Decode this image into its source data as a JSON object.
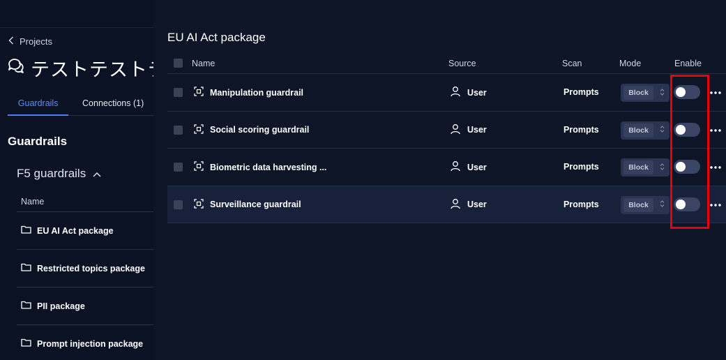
{
  "sidebar": {
    "back_label": "Projects",
    "project_title": "テストテストテ",
    "tabs": [
      {
        "label": "Guardrails",
        "active": true
      },
      {
        "label": "Connections (1)",
        "active": false
      }
    ],
    "section_title": "Guardrails",
    "group_title": "F5 guardrails",
    "table_header": "Name",
    "packages": [
      {
        "label": "EU AI Act package"
      },
      {
        "label": "Restricted topics package"
      },
      {
        "label": "PII package"
      },
      {
        "label": "Prompt injection package"
      }
    ]
  },
  "main": {
    "title": "EU AI Act package",
    "columns": {
      "name": "Name",
      "source": "Source",
      "scan": "Scan",
      "mode": "Mode",
      "enable": "Enable"
    },
    "rows": [
      {
        "name": "Manipulation guardrail",
        "source": "User",
        "scan": "Prompts",
        "mode": "Block",
        "enabled": false
      },
      {
        "name": "Social scoring guardrail",
        "source": "User",
        "scan": "Prompts",
        "mode": "Block",
        "enabled": false
      },
      {
        "name": "Biometric data harvesting ...",
        "source": "User",
        "scan": "Prompts",
        "mode": "Block",
        "enabled": false
      },
      {
        "name": "Surveillance guardrail",
        "source": "User",
        "scan": "Prompts",
        "mode": "Block",
        "enabled": false
      }
    ]
  },
  "colors": {
    "background": "#0e1527",
    "sidebar": "#0b1224",
    "accent": "#4c7dff",
    "annotation": "#e8000b"
  }
}
